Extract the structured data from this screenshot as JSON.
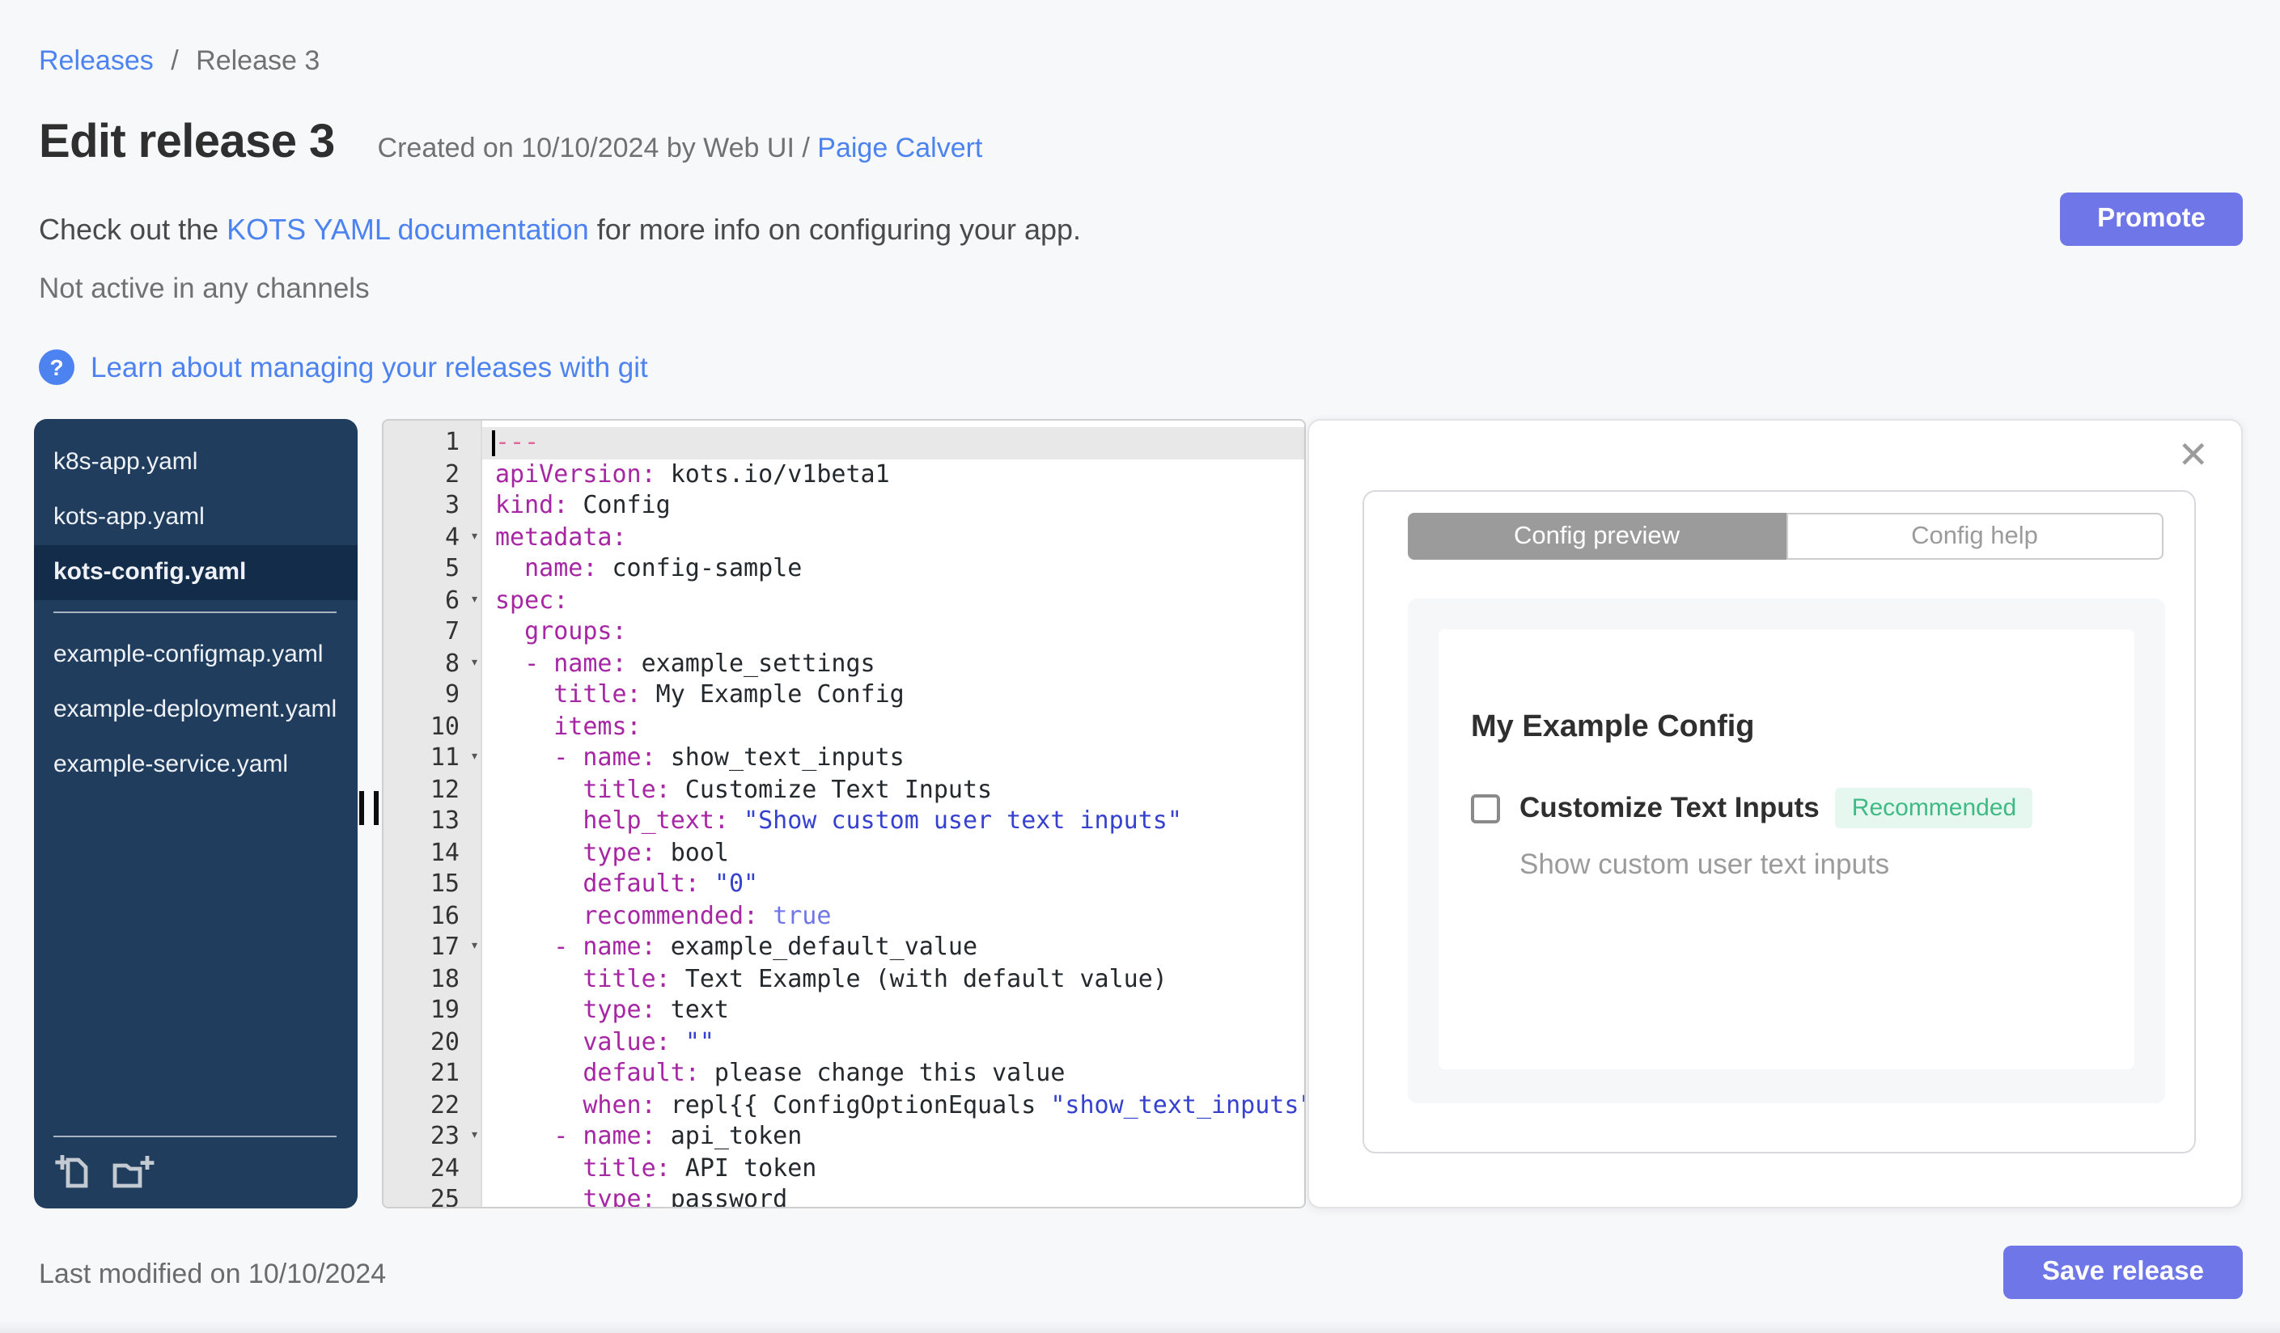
{
  "breadcrumb": {
    "link": "Releases",
    "separator": "/",
    "current": "Release 3"
  },
  "header": {
    "title": "Edit release 3",
    "created": "Created on 10/10/2024 by Web UI /",
    "author": "Paige Calvert"
  },
  "docs_note": {
    "prefix": "Check out the ",
    "link": "KOTS YAML documentation",
    "suffix": " for more info on configuring your app."
  },
  "channel_status": "Not active in any channels",
  "git_help": {
    "icon": "question-mark-icon",
    "icon_glyph": "?",
    "label": "Learn about managing your releases with git"
  },
  "actions": {
    "promote": "Promote",
    "save": "Save release"
  },
  "file_tree": {
    "files": [
      {
        "label": "k8s-app.yaml"
      },
      {
        "label": "kots-app.yaml"
      },
      {
        "label": "kots-config.yaml",
        "selected": true
      },
      {
        "divider": true
      },
      {
        "label": "example-configmap.yaml"
      },
      {
        "label": "example-deployment.yaml"
      },
      {
        "label": "example-service.yaml"
      }
    ],
    "footer_icons": [
      "new-file-icon",
      "new-folder-icon"
    ]
  },
  "editor": {
    "file": "kots-config.yaml",
    "lines": [
      {
        "n": 1,
        "active": true,
        "seg": [
          [
            "m",
            "---"
          ]
        ]
      },
      {
        "n": 2,
        "seg": [
          [
            "k",
            "apiVersion:"
          ],
          [
            "p",
            " kots.io/v1beta1"
          ]
        ]
      },
      {
        "n": 3,
        "seg": [
          [
            "k",
            "kind:"
          ],
          [
            "p",
            " Config"
          ]
        ]
      },
      {
        "n": 4,
        "fold": true,
        "seg": [
          [
            "k",
            "metadata:"
          ]
        ]
      },
      {
        "n": 5,
        "seg": [
          [
            "p",
            "  "
          ],
          [
            "k",
            "name:"
          ],
          [
            "p",
            " config-sample"
          ]
        ]
      },
      {
        "n": 6,
        "fold": true,
        "seg": [
          [
            "k",
            "spec:"
          ]
        ]
      },
      {
        "n": 7,
        "seg": [
          [
            "p",
            "  "
          ],
          [
            "k",
            "groups:"
          ]
        ]
      },
      {
        "n": 8,
        "fold": true,
        "seg": [
          [
            "p",
            "  "
          ],
          [
            "k",
            "- name:"
          ],
          [
            "p",
            " example_settings"
          ]
        ]
      },
      {
        "n": 9,
        "seg": [
          [
            "p",
            "    "
          ],
          [
            "k",
            "title:"
          ],
          [
            "p",
            " My Example Config"
          ]
        ]
      },
      {
        "n": 10,
        "seg": [
          [
            "p",
            "    "
          ],
          [
            "k",
            "items:"
          ]
        ]
      },
      {
        "n": 11,
        "fold": true,
        "seg": [
          [
            "p",
            "    "
          ],
          [
            "k",
            "- name:"
          ],
          [
            "p",
            " show_text_inputs"
          ]
        ]
      },
      {
        "n": 12,
        "seg": [
          [
            "p",
            "      "
          ],
          [
            "k",
            "title:"
          ],
          [
            "p",
            " Customize Text Inputs"
          ]
        ]
      },
      {
        "n": 13,
        "seg": [
          [
            "p",
            "      "
          ],
          [
            "k",
            "help_text:"
          ],
          [
            "p",
            " "
          ],
          [
            "s",
            "\"Show custom user text inputs\""
          ]
        ]
      },
      {
        "n": 14,
        "seg": [
          [
            "p",
            "      "
          ],
          [
            "k",
            "type:"
          ],
          [
            "p",
            " bool"
          ]
        ]
      },
      {
        "n": 15,
        "seg": [
          [
            "p",
            "      "
          ],
          [
            "k",
            "default:"
          ],
          [
            "p",
            " "
          ],
          [
            "s",
            "\"0\""
          ]
        ]
      },
      {
        "n": 16,
        "seg": [
          [
            "p",
            "      "
          ],
          [
            "k",
            "recommended:"
          ],
          [
            "p",
            " "
          ],
          [
            "t",
            "true"
          ]
        ]
      },
      {
        "n": 17,
        "fold": true,
        "seg": [
          [
            "p",
            "    "
          ],
          [
            "k",
            "- name:"
          ],
          [
            "p",
            " example_default_value"
          ]
        ]
      },
      {
        "n": 18,
        "seg": [
          [
            "p",
            "      "
          ],
          [
            "k",
            "title:"
          ],
          [
            "p",
            " Text Example (with default value)"
          ]
        ]
      },
      {
        "n": 19,
        "seg": [
          [
            "p",
            "      "
          ],
          [
            "k",
            "type:"
          ],
          [
            "p",
            " text"
          ]
        ]
      },
      {
        "n": 20,
        "seg": [
          [
            "p",
            "      "
          ],
          [
            "k",
            "value:"
          ],
          [
            "p",
            " "
          ],
          [
            "s",
            "\"\""
          ]
        ]
      },
      {
        "n": 21,
        "seg": [
          [
            "p",
            "      "
          ],
          [
            "k",
            "default:"
          ],
          [
            "p",
            " please change this value"
          ]
        ]
      },
      {
        "n": 22,
        "seg": [
          [
            "p",
            "      "
          ],
          [
            "k",
            "when:"
          ],
          [
            "p",
            " repl{{ ConfigOptionEquals "
          ],
          [
            "s",
            "\"show_text_inputs\""
          ]
        ]
      },
      {
        "n": 23,
        "fold": true,
        "seg": [
          [
            "p",
            "    "
          ],
          [
            "k",
            "- name:"
          ],
          [
            "p",
            " api_token"
          ]
        ]
      },
      {
        "n": 24,
        "seg": [
          [
            "p",
            "      "
          ],
          [
            "k",
            "title:"
          ],
          [
            "p",
            " API token"
          ]
        ]
      },
      {
        "n": 25,
        "seg": [
          [
            "p",
            "      "
          ],
          [
            "k",
            "type:"
          ],
          [
            "p",
            " password"
          ]
        ]
      }
    ]
  },
  "preview": {
    "close_glyph": "✕",
    "tabs": [
      {
        "label": "Config preview",
        "active": true
      },
      {
        "label": "Config help",
        "active": false
      }
    ],
    "group_title": "My Example Config",
    "item": {
      "label": "Customize Text Inputs",
      "badge": "Recommended",
      "help": "Show custom user text inputs",
      "checked": false
    }
  },
  "footer": {
    "last_modified": "Last modified on 10/10/2024"
  },
  "colors": {
    "accent": "#6e76e8",
    "link": "#4c83f0",
    "sidebar_bg": "#213d5e",
    "sidebar_selected_bg": "#122c4a",
    "badge_green": "#3fba84",
    "badge_green_bg": "#e6f7ef",
    "yaml_key": "#a626a4",
    "yaml_string": "#3642cf",
    "yaml_bool": "#6f76e8",
    "yaml_meta": "#e0669c",
    "tab_active_bg": "#9b9b9b"
  }
}
